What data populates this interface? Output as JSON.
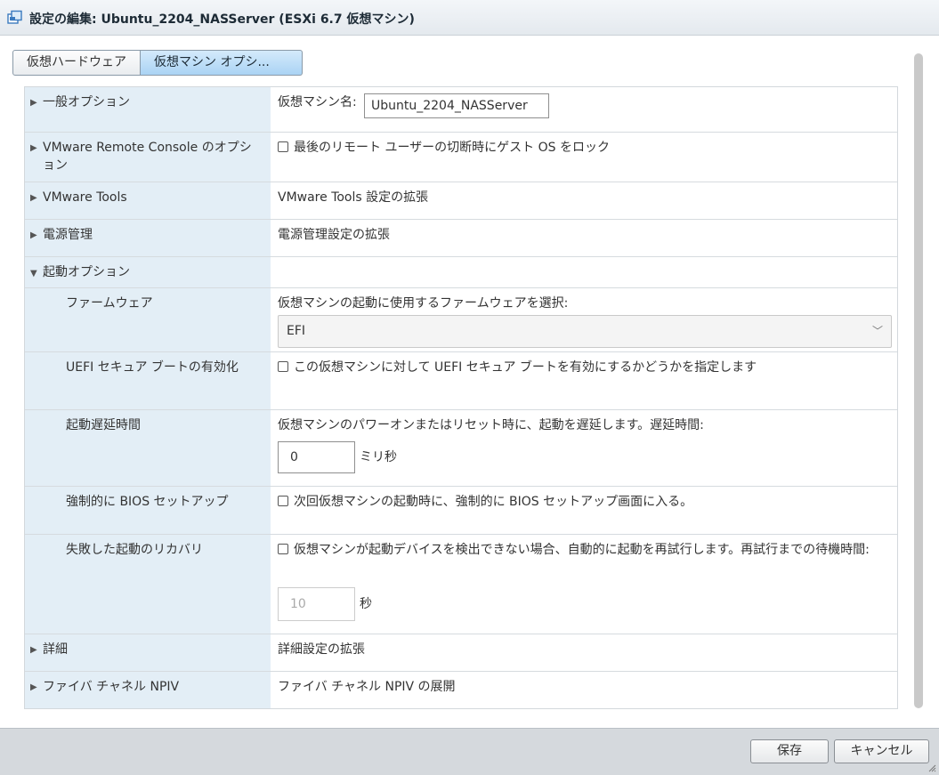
{
  "window": {
    "title": "設定の編集: Ubuntu_2204_NASServer (ESXi 6.7 仮想マシン)",
    "icon": "vm-settings-icon"
  },
  "tabs": [
    {
      "label": "仮想ハードウェア",
      "active": false
    },
    {
      "label": "仮想マシン オプシ...",
      "active": true
    }
  ],
  "rows": {
    "general": {
      "label": "一般オプション",
      "vm_name_label": "仮想マシン名:",
      "vm_name_value": "Ubuntu_2204_NASServer"
    },
    "vmrc": {
      "label": "VMware Remote Console のオプション",
      "checkbox_label": "最後のリモート ユーザーの切断時にゲスト OS をロック",
      "checked": false
    },
    "tools": {
      "label": "VMware Tools",
      "value": "VMware Tools 設定の拡張"
    },
    "power": {
      "label": "電源管理",
      "value": "電源管理設定の拡張"
    },
    "boot": {
      "label": "起動オプション"
    },
    "firmware": {
      "label": "ファームウェア",
      "description": "仮想マシンの起動に使用するファームウェアを選択:",
      "selected": "EFI"
    },
    "secure_boot": {
      "label": "UEFI セキュア ブートの有効化",
      "checkbox_label": "この仮想マシンに対して UEFI セキュア ブートを有効にするかどうかを指定します",
      "checked": false
    },
    "boot_delay": {
      "label": "起動遅延時間",
      "description": "仮想マシンのパワーオンまたはリセット時に、起動を遅延します。遅延時間:",
      "value": "0",
      "unit": "ミリ秒"
    },
    "force_bios": {
      "label": "強制的に BIOS セットアップ",
      "checkbox_label": "次回仮想マシンの起動時に、強制的に BIOS セットアップ画面に入る。",
      "checked": false
    },
    "recovery": {
      "label": "失敗した起動のリカバリ",
      "checkbox_label": "仮想マシンが起動デバイスを検出できない場合、自動的に起動を再試行します。再試行までの待機時間:",
      "checked": false,
      "value": "10",
      "unit": "秒"
    },
    "advanced": {
      "label": "詳細",
      "value": "詳細設定の拡張"
    },
    "npiv": {
      "label": "ファイバ チャネル NPIV",
      "value": "ファイバ チャネル NPIV の展開"
    }
  },
  "footer": {
    "save_label": "保存",
    "cancel_label": "キャンセル"
  },
  "colors": {
    "label_column": "#e3eef6",
    "active_tab": "#aad3f4",
    "footer": "#d5d9dd"
  }
}
